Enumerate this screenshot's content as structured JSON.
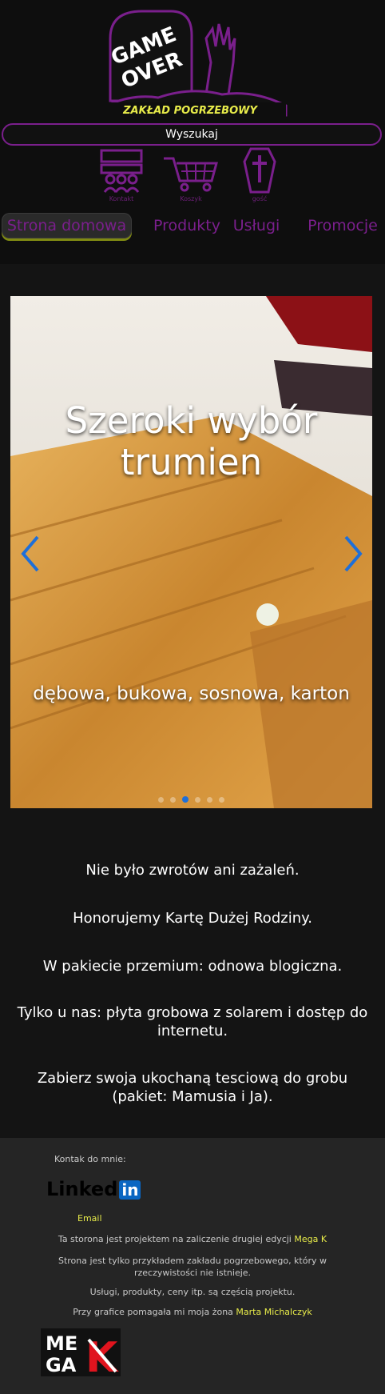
{
  "header": {
    "logo_line1": "GAME",
    "logo_line2": "OVER",
    "logo_banner": "ZAKŁAD POGRZEBOWY",
    "search_label": "Wyszukaj"
  },
  "icons": [
    {
      "label": "Kontakt",
      "icon": "people-icon"
    },
    {
      "label": "Koszyk",
      "icon": "cart-icon"
    },
    {
      "label": "gość",
      "icon": "coffin-icon"
    }
  ],
  "nav": [
    {
      "label": "Strona domowa",
      "active": true
    },
    {
      "label": "Produkty"
    },
    {
      "label": "Usługi"
    },
    {
      "label": "Promocje"
    }
  ],
  "carousel": {
    "title": "Szeroki wybór trumien",
    "subtitle": "dębowa, bukowa, sosnowa, karton",
    "slide_count": 6,
    "active_slide": 3
  },
  "features": [
    "Nie było zwrotów ani zażaleń.",
    "Honorujemy Kartę Dużej Rodziny.",
    "W pakiecie przemium: odnowa blogiczna.",
    "Tylko u nas: płyta grobowa z solarem i dostęp do internetu.",
    "Zabierz swoja ukochaną tesciową do grobu (pakiet: Mamusia i Ja)."
  ],
  "footer": {
    "contact_label": "Kontak do mnie:",
    "linkedin": "Linked",
    "linkedin_in": "in",
    "email": "Email",
    "project_text": "Ta storona jest projektem na zaliczenie drugiej edycji",
    "project_link": "Mega K",
    "disclaimer": "Strona jest tylko przykładem zakładu pogrzebowego, który w rzeczywistości nie istnieje.",
    "services_note": "Usługi, produkty, ceny itp. są częścią projektu.",
    "graphics_text": "Przy grafice pomagała mi moja żona",
    "graphics_link": "Marta Michalczyk",
    "mega_line1": "ME",
    "mega_line2": "GA",
    "mega_k": "K"
  },
  "colors": {
    "purple": "#7a1f8c",
    "yellow": "#e8ec4a",
    "accent_blue": "#1e6fd9"
  }
}
